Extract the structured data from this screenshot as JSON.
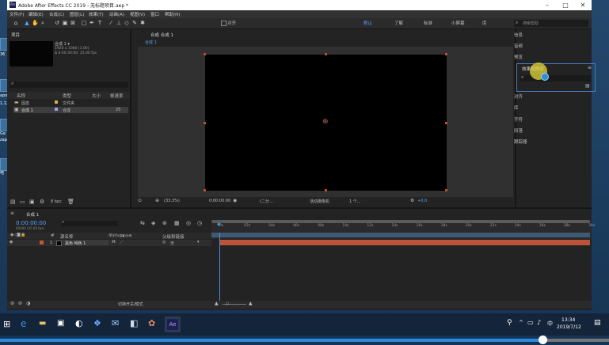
{
  "window": {
    "title": "Adobe After Effects CC 2019 - 无标题项目.aep *",
    "menu": [
      "文件(F)",
      "编辑(E)",
      "合成(C)",
      "图层(L)",
      "效果(T)",
      "动画(A)",
      "视图(V)",
      "窗口",
      "帮助(H)"
    ]
  },
  "toolbar": {
    "align_label": "对齐",
    "workspaces": [
      "默认",
      "了解",
      "标准",
      "小屏幕",
      "库"
    ],
    "search_placeholder": "搜索帮助"
  },
  "project": {
    "title": "项目",
    "comp_name": "合成 1 ▾",
    "comp_info": [
      "1920 x 1080 (1.00)",
      "Δ 0:00:30:00, 25.00 fps"
    ],
    "columns": [
      "名称",
      "类型",
      "大小",
      "帧速率"
    ],
    "rows": [
      {
        "name": "固态",
        "type": "文件夹",
        "size": "",
        "fps": ""
      },
      {
        "name": "合成 1",
        "type": "合成",
        "size": "",
        "fps": "25"
      }
    ],
    "bpc": "8 bpc"
  },
  "composition": {
    "tab": "合成 合成 1",
    "subtab": "合成 1",
    "zoom": "(33.3%)",
    "timecode": "0:00:00:00",
    "resolution": "(二分...",
    "camera": "活动摄像机",
    "views": "1 个...",
    "exposure": "+0.0"
  },
  "right_panels": {
    "items": [
      "信息",
      "音频",
      "预览",
      "效果和预设",
      "对齐",
      "库",
      "字符",
      "段落",
      "跟踪器"
    ],
    "active": "效果和预设"
  },
  "timeline": {
    "tab": "合成 1",
    "timecode": "0:00:00:00",
    "frame_info": "00000 (25.00 fps)",
    "columns": [
      "#",
      "源名称",
      "单♀\\fx▤◐◎⊕",
      "父级和链接"
    ],
    "layer": {
      "index": "1",
      "name": "黑色 纯色 1",
      "parent": "无"
    },
    "ruler": [
      "0s",
      "02s",
      "04s",
      "06s",
      "08s",
      "10s",
      "12s",
      "14s",
      "16s",
      "18s",
      "20s",
      "22s",
      "24s",
      "26s",
      "28s",
      "30s"
    ],
    "toggle_label": "切换开关/模式",
    "layer_color": "#c2553a"
  },
  "taskbar": {
    "time": "13:34",
    "date": "2019/7/12",
    "lang": "中"
  },
  "desktop": {
    "labels": [
      "36",
      "apo",
      "1.12",
      "Ge",
      "zap",
      "电"
    ]
  }
}
